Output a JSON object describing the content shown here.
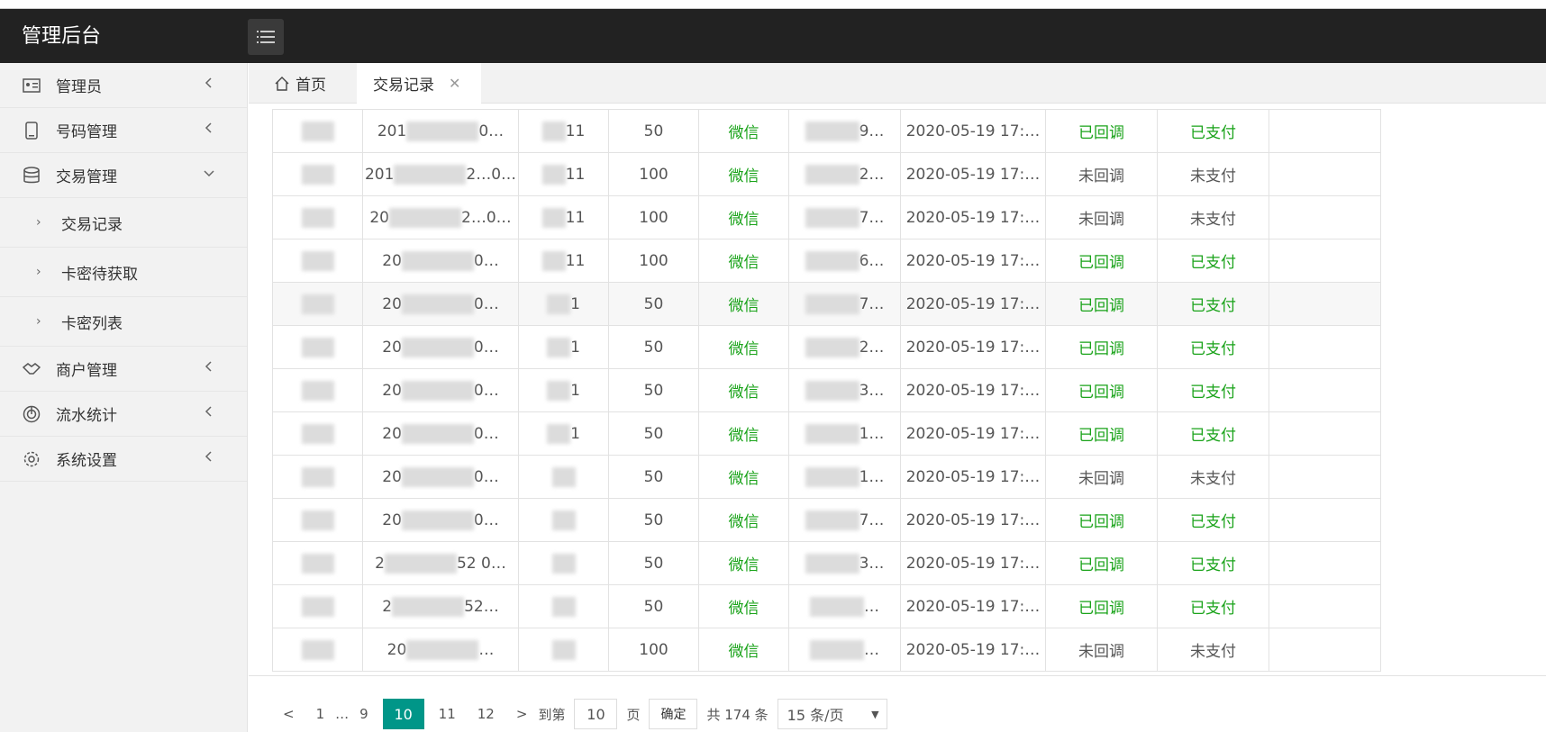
{
  "app": {
    "title": "管理后台"
  },
  "sidebar": {
    "items": [
      {
        "label": "管理员",
        "icon": "id-card-icon"
      },
      {
        "label": "号码管理",
        "icon": "phone-icon"
      },
      {
        "label": "交易管理",
        "icon": "database-icon"
      },
      {
        "label": "商户管理",
        "icon": "handshake-icon"
      },
      {
        "label": "流水统计",
        "icon": "chart-icon"
      },
      {
        "label": "系统设置",
        "icon": "gear-icon"
      }
    ],
    "subitems": [
      {
        "label": "交易记录"
      },
      {
        "label": "卡密待获取"
      },
      {
        "label": "卡密列表"
      }
    ]
  },
  "tabs": {
    "home": "首页",
    "active": "交易记录"
  },
  "table": {
    "rows": [
      {
        "order": "201",
        "suffix": "0…",
        "acct": "11",
        "amount": "50",
        "channel": "微信",
        "ref": "9…",
        "time": "2020-05-19 17:…",
        "callback": "已回调",
        "pay": "已支付"
      },
      {
        "order": "201",
        "suffix": "2…0…",
        "acct": "11",
        "amount": "100",
        "channel": "微信",
        "ref": "2…",
        "time": "2020-05-19 17:…",
        "callback": "未回调",
        "pay": "未支付"
      },
      {
        "order": "20",
        "suffix": "2…0…",
        "acct": "11",
        "amount": "100",
        "channel": "微信",
        "ref": "7…",
        "time": "2020-05-19 17:…",
        "callback": "未回调",
        "pay": "未支付"
      },
      {
        "order": "20",
        "suffix": "0…",
        "acct": "11",
        "amount": "100",
        "channel": "微信",
        "ref": "6…",
        "time": "2020-05-19 17:…",
        "callback": "已回调",
        "pay": "已支付"
      },
      {
        "order": "20",
        "suffix": "0…",
        "acct": "1",
        "amount": "50",
        "channel": "微信",
        "ref": "7…",
        "time": "2020-05-19 17:…",
        "callback": "已回调",
        "pay": "已支付"
      },
      {
        "order": "20",
        "suffix": "0…",
        "acct": "1",
        "amount": "50",
        "channel": "微信",
        "ref": "2…",
        "time": "2020-05-19 17:…",
        "callback": "已回调",
        "pay": "已支付"
      },
      {
        "order": "20",
        "suffix": "0…",
        "acct": "1",
        "amount": "50",
        "channel": "微信",
        "ref": "3…",
        "time": "2020-05-19 17:…",
        "callback": "已回调",
        "pay": "已支付"
      },
      {
        "order": "20",
        "suffix": "0…",
        "acct": "1",
        "amount": "50",
        "channel": "微信",
        "ref": "1…",
        "time": "2020-05-19 17:…",
        "callback": "已回调",
        "pay": "已支付"
      },
      {
        "order": "20",
        "suffix": "0…",
        "acct": "",
        "amount": "50",
        "channel": "微信",
        "ref": "1…",
        "time": "2020-05-19 17:…",
        "callback": "未回调",
        "pay": "未支付"
      },
      {
        "order": "20",
        "suffix": "0…",
        "acct": "",
        "amount": "50",
        "channel": "微信",
        "ref": "7…",
        "time": "2020-05-19 17:…",
        "callback": "已回调",
        "pay": "已支付"
      },
      {
        "order": "2",
        "suffix": "52 0…",
        "acct": "",
        "amount": "50",
        "channel": "微信",
        "ref": "3…",
        "time": "2020-05-19 17:…",
        "callback": "已回调",
        "pay": "已支付"
      },
      {
        "order": "2",
        "suffix": "52…",
        "acct": "",
        "amount": "50",
        "channel": "微信",
        "ref": "…",
        "time": "2020-05-19 17:…",
        "callback": "已回调",
        "pay": "已支付"
      },
      {
        "order": "20",
        "suffix": "…",
        "acct": "",
        "amount": "100",
        "channel": "微信",
        "ref": "…",
        "time": "2020-05-19 17:…",
        "callback": "未回调",
        "pay": "未支付"
      }
    ]
  },
  "pager": {
    "prev": "<",
    "first": "1",
    "ellipsis": "…",
    "p9": "9",
    "current": "10",
    "p11": "11",
    "p12": "12",
    "next": ">",
    "goto_label": "到第",
    "goto_value": "10",
    "page_label": "页",
    "confirm": "确定",
    "total": "共 174 条",
    "per_page": "15 条/页"
  },
  "colors": {
    "accent": "#009688",
    "green": "#1aa31a",
    "header": "#222222"
  }
}
